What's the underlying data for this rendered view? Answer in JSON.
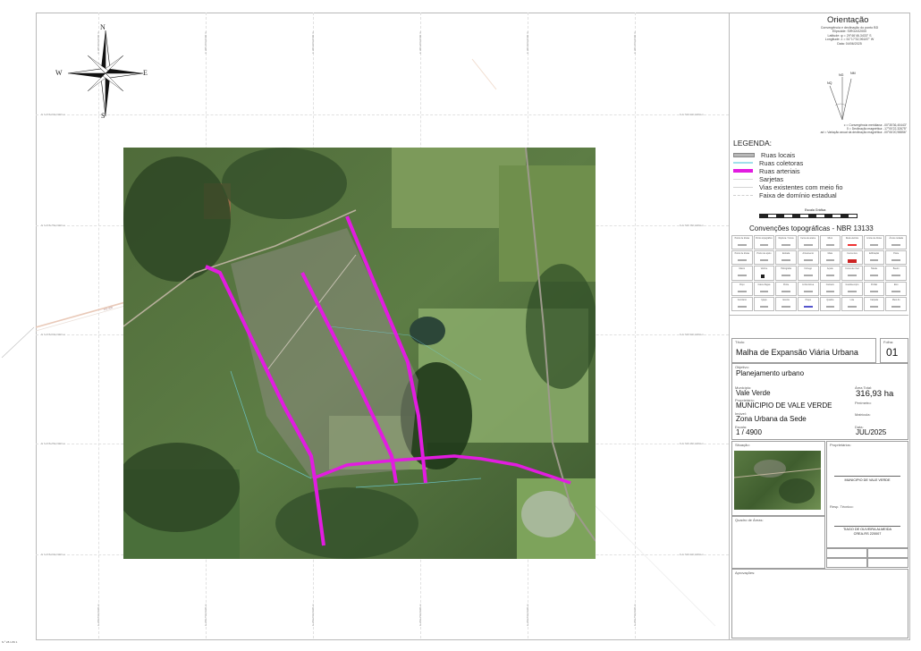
{
  "orientation": {
    "title": "Orientação",
    "lines": [
      "Convergência e declinação do ponto   BD",
      "Elipsóide: SIRGAS2000",
      "Latitude: φ = 29°46'46,3433\" S",
      "Longitude: λ = 51°17'32,96187\" W",
      "Data: 04/06/2025"
    ],
    "arrow_labels": [
      "NQ",
      "NG",
      "NM"
    ],
    "notes": [
      "c = Convergência meridiana: -00°35'36,40443\"",
      "δ = Declinação magnética: -17°00'22,32675\"",
      "ad = Variação anual da declinação magnética: -00°06'20,98856\""
    ]
  },
  "compass": {
    "n": "N",
    "s": "S",
    "e": "E",
    "w": "W"
  },
  "legend": {
    "title": "LEGENDA:",
    "items": [
      {
        "label": "Ruas locais",
        "color": "#b7b7b7"
      },
      {
        "label": "Ruas coletoras",
        "color": "#9fe0ea"
      },
      {
        "label": "Ruas arteriais",
        "color": "#e21ce0"
      },
      {
        "label": "Sarjetas",
        "color": "#dadada"
      },
      {
        "label": "Vias existentes com meio fio",
        "color": "#d4d4d4"
      },
      {
        "label": "Faixa de domínio estadual",
        "color": "#cfcfcf"
      }
    ],
    "scale_title": "Escala Gráfica"
  },
  "conventions": {
    "title": "Convenções topográficas - NBR 13133",
    "cells": [
      "Ponto de divisa",
      "Ponto topográfico",
      "Ruptura / Curva",
      "Cerca de arame",
      "Muro",
      "Rede elétrica",
      "Limite de divisa",
      "Árvore isolada",
      "Ponto de divisa",
      "Ponto de apoio",
      "Estrada",
      "Arruamento",
      "Mata",
      "Cerca viva",
      "Edificação",
      "Poste",
      "Marco",
      "Vértice",
      "Hidrografia",
      "Córrego",
      "Açude",
      "Curva de nível",
      "Talude",
      "Bueiro",
      "Poço",
      "Caixa d'água",
      "Ponte",
      "Linha férrea",
      "Canteiro",
      "Guarda-corpo",
      "Portão",
      "Eixo",
      "Cemitério",
      "Igreja",
      "Escola",
      "Praça",
      "Quadra",
      "Lote",
      "Calçada",
      "Meio-fio"
    ]
  },
  "title_block": {
    "titulo_label": "Título:",
    "titulo": "Malha de Expansão Viária Urbana",
    "folha_label": "Folha:",
    "folha": "01",
    "objetivo_label": "Objetivo:",
    "objetivo": "Planejamento urbano",
    "municipio_label": "Município:",
    "municipio": "Vale Verde",
    "area_label": "Área Total:",
    "area": "316,93 ha",
    "proprietario_label": "Proprietário:",
    "proprietario": "MUNICIPIO DE VALE VERDE",
    "perimetro_label": "Perímetro:",
    "imovel_label": "Imóvel:",
    "imovel": "Zona Urbana da Sede",
    "matricula_label": "Matrícula:",
    "escala_label": "Escala:",
    "escala": "1 / 4900",
    "data_label": "Data:",
    "data": "JUL/2025"
  },
  "lower_blocks": {
    "situacao_label": "Situação:",
    "proprietarios_label": "Proprietários:",
    "prop_sig": "MUNICIPIO DE VALE VERDE",
    "resp_label": "Resp. Técnico:",
    "tech_name": "TIAGO DE OLIVEIRA ALMEIDA",
    "tech_reg": "CREA-RS 220007",
    "quadro_label": "Quadro de Áreas:",
    "aprovacoes_label": "Aprovações:"
  },
  "map": {
    "northing_labels": [
      "N 6.706.000,0000 m",
      "N 6.705.750,0000 m",
      "N 6.705.500,0000 m",
      "N 6.705.250,0000 m",
      "N 6.705.000,0000 m"
    ],
    "easting_labels": [
      "E 388.500,0000 m",
      "E 388.750,0000 m",
      "E 389.000,0000 m",
      "E 389.250,0000 m",
      "E 389.500,0000 m",
      "E 389.750,0000 m"
    ],
    "road_label": "RS-400",
    "footer": "N.º 28.1.83 1"
  }
}
